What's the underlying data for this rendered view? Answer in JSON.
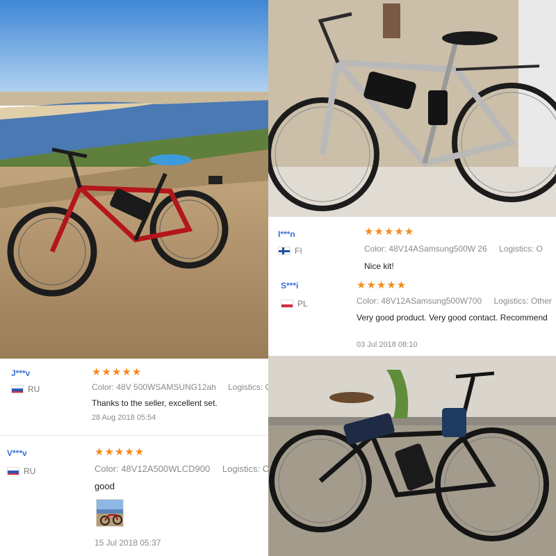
{
  "reviews": [
    {
      "user": "I***n",
      "country": "FI",
      "stars": "★★★★★",
      "color_label": "Color:",
      "color_value": "48V14ASamsung500W 26",
      "logistics_label": "Logistics:",
      "logistics_value": "O",
      "text": "Nice kit!",
      "date": ""
    },
    {
      "user": "S***i",
      "country": "PL",
      "stars": "★★★★★",
      "color_label": "Color:",
      "color_value": "48V12ASamsung500W700",
      "logistics_label": "Logistics:",
      "logistics_value": "Other",
      "text": "Very good product. Very good contact. Recommend",
      "date": "03 Jul 2018 08:10"
    },
    {
      "user": "J***v",
      "country": "RU",
      "stars": "★★★★★",
      "color_label": "Color:",
      "color_value": "48V 500WSAMSUNG12ah",
      "logistics_label": "Logistics:",
      "logistics_value": "O",
      "text": "Thanks to the seller, excellent set.",
      "date": "28 Aug 2018 05:54"
    },
    {
      "user": "V***v",
      "country": "RU",
      "stars": "★★★★★",
      "color_label": "Color:",
      "color_value": "48V12A500WLCD900",
      "logistics_label": "Logistics:",
      "logistics_value": "O",
      "text": "good",
      "date": "15 Jul 2018 05:37"
    }
  ],
  "colors": {
    "star": "#f5891e",
    "username": "#3a6fd8",
    "sky": "#6aa7e6",
    "river": "#4e7fb8",
    "ground": "#b0926b"
  }
}
